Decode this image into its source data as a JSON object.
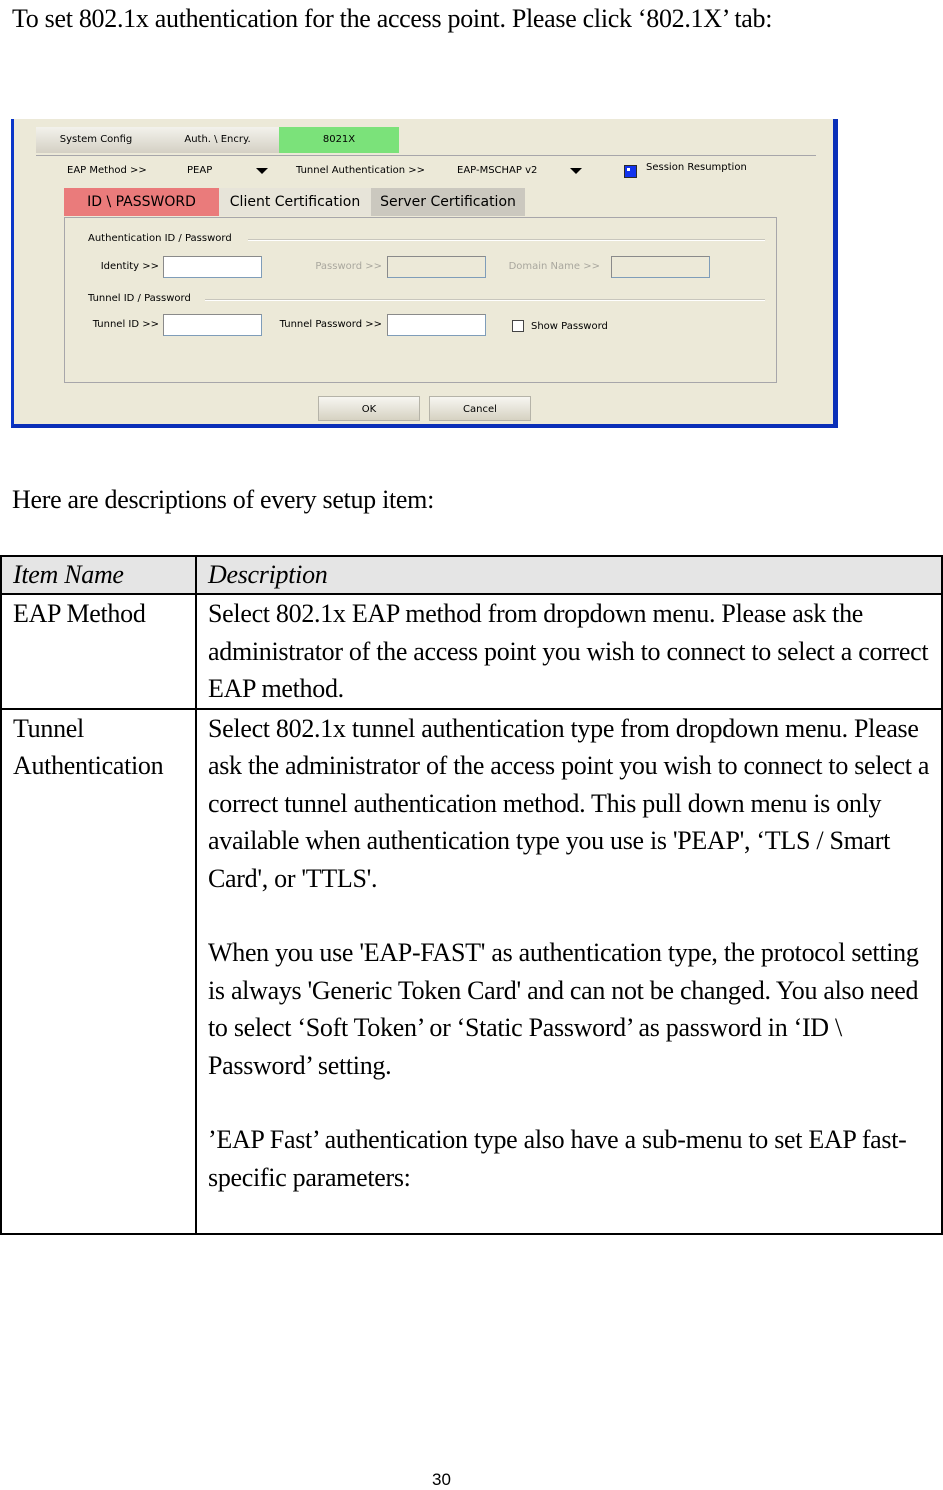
{
  "intro": "To set 802.1x authentication for the access point. Please click ‘802.1X’ tab:",
  "dialog": {
    "top_tabs": [
      "System Config",
      "Auth. \\ Encry.",
      "8021X"
    ],
    "active_top_tab": "8021X",
    "eap_method_label": "EAP Method >>",
    "eap_method_value": "PEAP",
    "tunnel_auth_label": "Tunnel Authentication >>",
    "tunnel_auth_value": "EAP-MSCHAP v2",
    "session_resumption_label": "Session Resumption",
    "session_resumption_checked": true,
    "inner_tabs": [
      "ID \\ PASSWORD",
      "Client Certification",
      "Server Certification"
    ],
    "active_inner_tab": "ID \\ PASSWORD",
    "group_auth": "Authentication ID / Password",
    "identity_label": "Identity >>",
    "identity_value": "",
    "password_label": "Password >>",
    "password_value": "",
    "domain_label": "Domain Name >>",
    "domain_value": "",
    "group_tunnel": "Tunnel ID / Password",
    "tunnel_id_label": "Tunnel ID >>",
    "tunnel_id_value": "",
    "tunnel_password_label": "Tunnel Password >>",
    "tunnel_password_value": "",
    "show_password_label": "Show Password",
    "show_password_checked": false,
    "ok_label": "OK",
    "cancel_label": "Cancel",
    "colors": {
      "active_top_tab": "#7be27a",
      "active_inner_tab": "#ea7b7b",
      "window_border": "#0a36c9",
      "background": "#ece9d8"
    }
  },
  "subhead": "Here are descriptions of every setup item:",
  "table": {
    "headers": [
      "Item Name",
      "Description"
    ],
    "rows": [
      {
        "name": "EAP Method",
        "paragraphs": [
          "Select 802.1x EAP method from dropdown menu. Please ask the administrator of the access point you wish to connect to select a correct EAP method."
        ]
      },
      {
        "name": "Tunnel Authentication",
        "paragraphs": [
          "Select 802.1x tunnel authentication type from dropdown menu. Please ask the administrator of the access point you wish to connect to select a correct tunnel authentication method. This pull down menu is only available when authentication type you use is 'PEAP', ‘TLS / Smart Card', or 'TTLS'.",
          "When you use 'EAP-FAST' as authentication type, the protocol setting is always 'Generic Token Card' and can not be changed. You also need to select ‘Soft Token’ or ‘Static Password’ as password in ‘ID \\ Password’ setting.",
          "’EAP Fast’ authentication type also have a sub-menu to set EAP fast-specific parameters:"
        ]
      }
    ]
  },
  "page_number": "30"
}
